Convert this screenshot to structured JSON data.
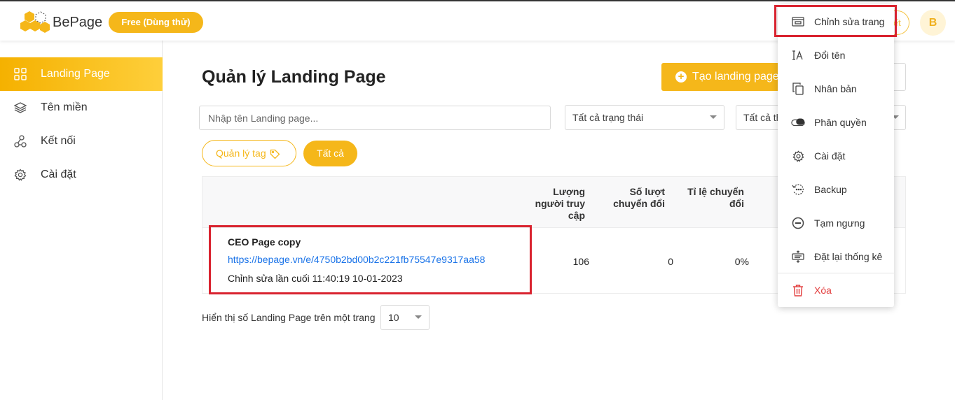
{
  "header": {
    "brand": "BePage",
    "plan_badge": "Free (Dùng thử)",
    "avatar_initial": "B",
    "partial_pill_text": "iết"
  },
  "sidebar": {
    "items": [
      {
        "label": "Landing Page",
        "icon": "grid-icon",
        "active": true
      },
      {
        "label": "Tên miền",
        "icon": "layers-icon",
        "active": false
      },
      {
        "label": "Kết nối",
        "icon": "connect-icon",
        "active": false
      },
      {
        "label": "Cài đặt",
        "icon": "gear-icon",
        "active": false
      }
    ]
  },
  "main": {
    "title": "Quản lý Landing Page",
    "create_button": "Tạo landing page",
    "search_placeholder": "Nhập tên Landing page...",
    "status_filter": "Tất cả trạng thái",
    "second_filter": "Tất cả th",
    "tag_button": "Quản lý tag",
    "all_button": "Tất cả"
  },
  "table": {
    "headers": {
      "visitors": [
        "Lượng",
        "người truy",
        "cập"
      ],
      "conversions": [
        "Số lượt",
        "chuyển đổi"
      ],
      "rate": [
        "Tỉ lệ chuyển",
        "đổi"
      ]
    },
    "rows": [
      {
        "name": "CEO Page copy",
        "url": "https://bepage.vn/e/4750b2bd00b2c221fb75547e9317aa58",
        "edited": "Chỉnh sửa lần cuối 11:40:19 10-01-2023",
        "visitors": "106",
        "conversions": "0",
        "rate": "0%"
      }
    ]
  },
  "pagination": {
    "label": "Hiển thị số Landing Page trên một trang",
    "page_size": "10"
  },
  "context_menu": {
    "items": [
      {
        "label": "Chỉnh sửa trang",
        "icon": "edit-page-icon"
      },
      {
        "label": "Đổi tên",
        "icon": "rename-icon"
      },
      {
        "label": "Nhân bản",
        "icon": "duplicate-icon"
      },
      {
        "label": "Phân quyền",
        "icon": "permission-toggle-icon"
      },
      {
        "label": "Cài đặt",
        "icon": "gear-icon"
      },
      {
        "label": "Backup",
        "icon": "backup-icon"
      },
      {
        "label": "Tạm ngưng",
        "icon": "pause-icon"
      },
      {
        "label": "Đặt lại thống kê",
        "icon": "reset-stats-icon"
      },
      {
        "label": "Xóa",
        "icon": "trash-icon"
      }
    ]
  },
  "colors": {
    "accent": "#f5b71a",
    "highlight_border": "#d9232f",
    "link": "#1a73e8",
    "danger": "#e23b3b"
  }
}
